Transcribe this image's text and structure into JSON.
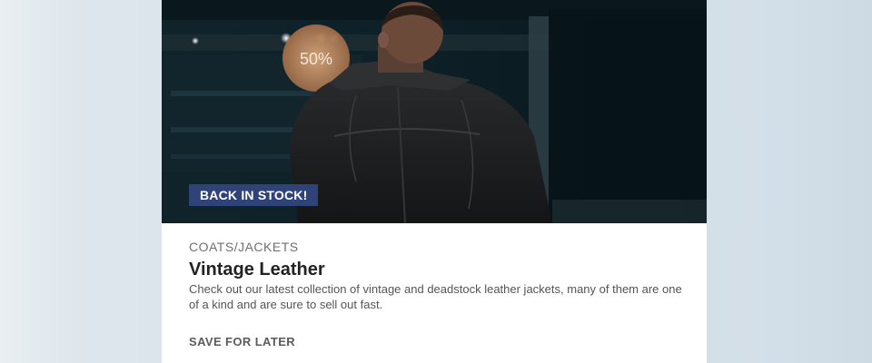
{
  "card": {
    "badge": "BACK IN STOCK!",
    "category": "COATS/JACKETS",
    "title": "Vintage Leather",
    "description": "Check out our latest collection of vintage and deadstock leather jackets, many of them are one of a kind and are sure to sell out fast.",
    "action_label": "SAVE FOR LATER",
    "store_sign": "50%"
  },
  "colors": {
    "badge_bg": "#2f4379",
    "card_bg": "#ffffff"
  }
}
